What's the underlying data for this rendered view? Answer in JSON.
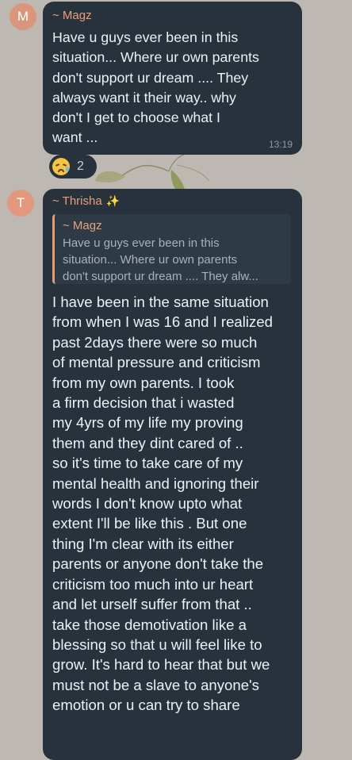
{
  "messages": [
    {
      "avatar_letter": "M",
      "sender": "~ Magz",
      "lines": [
        "Have u guys ever been in this",
        "situation... Where ur own parents",
        "don't support ur dream .... They",
        "always want it their way..  why",
        "don't I get to choose what I",
        "want ..."
      ],
      "time": "13:19",
      "reaction": {
        "emoji": "sad-tear-face",
        "count": "2"
      }
    },
    {
      "avatar_letter": "T",
      "sender": "~ Thrisha",
      "sender_emoji": "✨",
      "reply": {
        "sender": "~ Magz",
        "lines": [
          "Have u guys ever been in this",
          "situation... Where ur own parents",
          "don't support ur dream .... They alw..."
        ]
      },
      "lines": [
        "I have been in the same situation",
        "from when I was 16 and I realized",
        "past 2days there were so much",
        "of mental pressure and criticism",
        "from my own parents.  I took",
        "a firm decision that i wasted",
        "my 4yrs of my life my proving",
        "them and they dint cared of ..",
        "so it's time  to take care of my",
        "mental health and ignoring their",
        "words I don't know upto what",
        "extent I'll be like this . But one",
        "thing I'm clear with its either",
        "parents or anyone don't take the",
        "criticism too much into ur heart",
        "and let urself suffer from that ..",
        "take those demotivation like a",
        "blessing so that u will feel like to",
        "grow. It's hard to hear that but we",
        "must not be a slave to anyone's",
        "emotion or u can try to share"
      ]
    }
  ]
}
